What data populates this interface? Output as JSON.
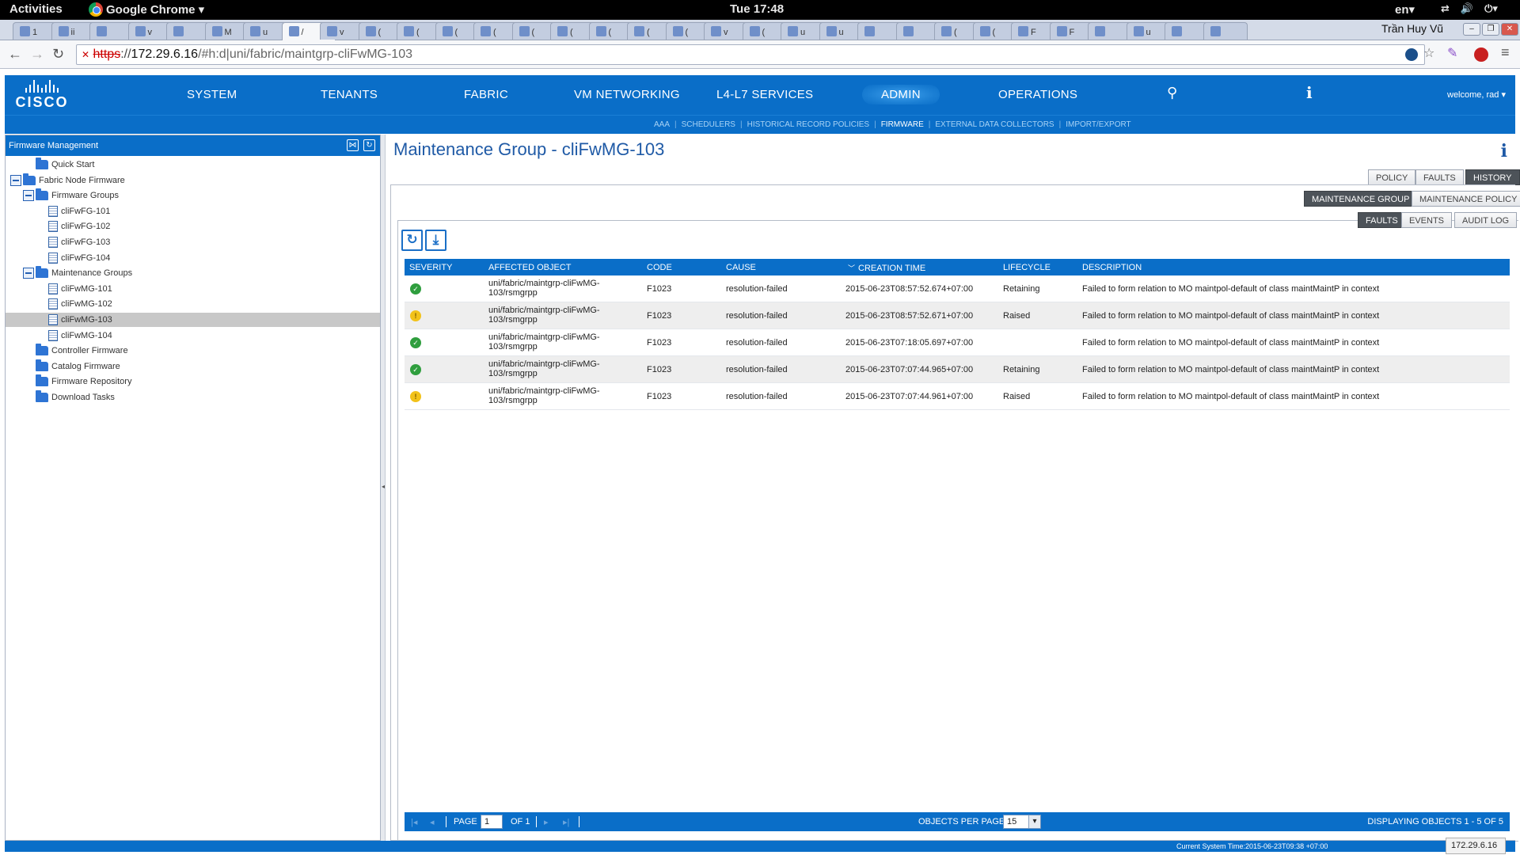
{
  "os_bar": {
    "activities": "Activities",
    "app_menu": "Google Chrome ▾",
    "clock": "Tue 17:48",
    "lang": "en▾"
  },
  "browser": {
    "user_name": "Trần Huy Vũ",
    "url": {
      "scheme": "https",
      "host": "172.29.6.16",
      "path": "/#h:d|uni/fabric/maintgrp-cliFwMG-103"
    },
    "tabs": [
      "1",
      "ii",
      "",
      "v",
      "",
      "M",
      "u",
      "/",
      "v",
      "(",
      "(",
      "(",
      "(",
      "(",
      "(",
      "(",
      "(",
      "(",
      "v",
      "(",
      "u",
      "u",
      "",
      "",
      "(",
      "(",
      "F",
      "F",
      "",
      "u",
      "",
      ""
    ]
  },
  "apic": {
    "nav": [
      "SYSTEM",
      "TENANTS",
      "FABRIC",
      "VM NETWORKING",
      "L4-L7 SERVICES",
      "ADMIN",
      "OPERATIONS"
    ],
    "active_nav": "ADMIN",
    "logo_text": "CISCO",
    "info_glyph": "i",
    "welcome": "welcome, rad ▾",
    "subnav": [
      "AAA",
      "SCHEDULERS",
      "HISTORICAL RECORD POLICIES",
      "FIRMWARE",
      "EXTERNAL DATA COLLECTORS",
      "IMPORT/EXPORT"
    ],
    "active_subnav": "FIRMWARE"
  },
  "left_panel": {
    "title": "Firmware Management",
    "tree": [
      {
        "label": "Quick Start",
        "icon": "folder-icon",
        "depth": 1,
        "expander": false
      },
      {
        "label": "Fabric Node Firmware",
        "icon": "folder-icon",
        "depth": 0,
        "expander": true
      },
      {
        "label": "Firmware Groups",
        "icon": "folder-icon",
        "depth": 1,
        "expander": true
      },
      {
        "label": "cliFwFG-101",
        "icon": "document-icon",
        "depth": 2,
        "expander": false
      },
      {
        "label": "cliFwFG-102",
        "icon": "document-icon",
        "depth": 2,
        "expander": false
      },
      {
        "label": "cliFwFG-103",
        "icon": "document-icon",
        "depth": 2,
        "expander": false
      },
      {
        "label": "cliFwFG-104",
        "icon": "document-icon",
        "depth": 2,
        "expander": false
      },
      {
        "label": "Maintenance Groups",
        "icon": "folder-icon",
        "depth": 1,
        "expander": true
      },
      {
        "label": "cliFwMG-101",
        "icon": "document-icon",
        "depth": 2,
        "expander": false
      },
      {
        "label": "cliFwMG-102",
        "icon": "document-icon",
        "depth": 2,
        "expander": false
      },
      {
        "label": "cliFwMG-103",
        "icon": "document-icon",
        "depth": 2,
        "expander": false,
        "selected": true
      },
      {
        "label": "cliFwMG-104",
        "icon": "document-icon",
        "depth": 2,
        "expander": false
      },
      {
        "label": "Controller Firmware",
        "icon": "folder-icon",
        "depth": 1,
        "expander": false
      },
      {
        "label": "Catalog Firmware",
        "icon": "folder-icon",
        "depth": 1,
        "expander": false
      },
      {
        "label": "Firmware Repository",
        "icon": "folder-icon",
        "depth": 1,
        "expander": false
      },
      {
        "label": "Download Tasks",
        "icon": "folder-icon",
        "depth": 1,
        "expander": false
      }
    ]
  },
  "content": {
    "title": "Maintenance Group - cliFwMG-103",
    "info_glyph": "i",
    "top_tabs": [
      {
        "label": "POLICY",
        "active": false
      },
      {
        "label": "FAULTS",
        "active": false
      },
      {
        "label": "HISTORY",
        "active": true
      }
    ],
    "second_tabs": [
      {
        "label": "MAINTENANCE GROUP",
        "active": true
      },
      {
        "label": "MAINTENANCE POLICY",
        "active": false
      }
    ],
    "third_tabs": [
      {
        "label": "FAULTS",
        "active": true
      },
      {
        "label": "EVENTS",
        "active": false
      },
      {
        "label": "AUDIT LOG",
        "active": false
      }
    ],
    "columns": [
      "SEVERITY",
      "AFFECTED OBJECT",
      "CODE",
      "CAUSE",
      "CREATION TIME",
      "LIFECYCLE",
      "DESCRIPTION"
    ],
    "sort_column": "CREATION TIME",
    "rows": [
      {
        "severity": "cleared",
        "affected_object": "uni/fabric/maintgrp-cliFwMG-103/rsmgrpp",
        "code": "F1023",
        "cause": "resolution-failed",
        "creation_time": "2015-06-23T08:57:52.674+07:00",
        "lifecycle": "Retaining",
        "description": "Failed to form relation to MO maintpol-default of class maintMaintP in context"
      },
      {
        "severity": "warning",
        "affected_object": "uni/fabric/maintgrp-cliFwMG-103/rsmgrpp",
        "code": "F1023",
        "cause": "resolution-failed",
        "creation_time": "2015-06-23T08:57:52.671+07:00",
        "lifecycle": "Raised",
        "description": "Failed to form relation to MO maintpol-default of class maintMaintP in context"
      },
      {
        "severity": "cleared",
        "affected_object": "uni/fabric/maintgrp-cliFwMG-103/rsmgrpp",
        "code": "F1023",
        "cause": "resolution-failed",
        "creation_time": "2015-06-23T07:18:05.697+07:00",
        "lifecycle": "",
        "description": "Failed to form relation to MO maintpol-default of class maintMaintP in context"
      },
      {
        "severity": "cleared",
        "affected_object": "uni/fabric/maintgrp-cliFwMG-103/rsmgrpp",
        "code": "F1023",
        "cause": "resolution-failed",
        "creation_time": "2015-06-23T07:07:44.965+07:00",
        "lifecycle": "Retaining",
        "description": "Failed to form relation to MO maintpol-default of class maintMaintP in context"
      },
      {
        "severity": "warning",
        "affected_object": "uni/fabric/maintgrp-cliFwMG-103/rsmgrpp",
        "code": "F1023",
        "cause": "resolution-failed",
        "creation_time": "2015-06-23T07:07:44.961+07:00",
        "lifecycle": "Raised",
        "description": "Failed to form relation to MO maintpol-default of class maintMaintP in context"
      }
    ],
    "pager": {
      "page_label": "PAGE",
      "page_value": "1",
      "of_label": "OF 1",
      "per_page_label": "OBJECTS PER PAGE:",
      "per_page_value": "15",
      "displaying": "DISPLAYING OBJECTS 1 - 5 OF 5"
    }
  },
  "status": {
    "system_time": "Current System Time:2015-06-23T09:38 +07:00",
    "host_tooltip": "172.29.6.16"
  },
  "colors": {
    "apic_blue": "#0a6ec8",
    "title_blue": "#1f5aa6",
    "severity_cleared": "#2f9e3e",
    "severity_warning": "#f2c21a"
  }
}
